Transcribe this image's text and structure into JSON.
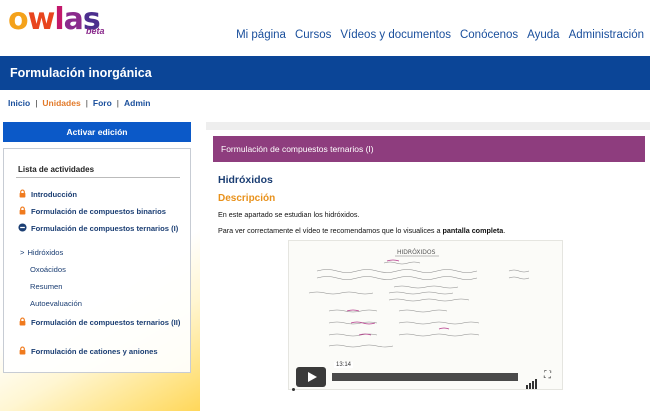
{
  "header": {
    "logo": "owlas",
    "logo_badge": "beta",
    "nav": [
      "Mi página",
      "Cursos",
      "Vídeos y documentos",
      "Conócenos",
      "Ayuda",
      "Administración"
    ]
  },
  "course": {
    "title": "Formulación inorgánica"
  },
  "breadcrumb": {
    "items": [
      "Inicio",
      "Unidades",
      "Foro",
      "Admin"
    ],
    "active": "Unidades"
  },
  "sidebar": {
    "activar_label": "Activar edición",
    "list_title": "Lista de actividades",
    "activities": [
      {
        "label": "Introducción",
        "icon": "lock-icon"
      },
      {
        "label": "Formulación de compuestos binarios",
        "icon": "lock-icon"
      },
      {
        "label": "Formulación de compuestos ternarios (I)",
        "icon": "minus-circle-icon"
      },
      {
        "label": "Formulación de compuestos ternarios (II)",
        "icon": "lock-icon"
      },
      {
        "label": "Formulación de cationes y aniones",
        "icon": "lock-icon"
      }
    ],
    "subitems": [
      {
        "label": "Hidróxidos",
        "current": true
      },
      {
        "label": "Oxoácidos"
      },
      {
        "label": "Resumen"
      },
      {
        "label": "Autoevaluación"
      }
    ]
  },
  "content": {
    "section_title": "Formulación de compuestos ternarios (I)",
    "heading": "Hidróxidos",
    "subheading": "Descripción",
    "paragraph1": "En este apartado se estudian los hidróxidos.",
    "paragraph2_pre": "Para ver correctamente el vídeo te recomendamos que lo visualices a ",
    "paragraph2_bold": "pantalla completa",
    "paragraph2_post": ".",
    "video": {
      "board_title": "HIDRÓXIDOS",
      "time": "13:14",
      "progress": 0.0
    }
  },
  "colors": {
    "brand_blue": "#0b4597",
    "accent_orange": "#e8911b",
    "purple_band": "#8e3d7e",
    "lock_orange": "#f07a1d"
  }
}
